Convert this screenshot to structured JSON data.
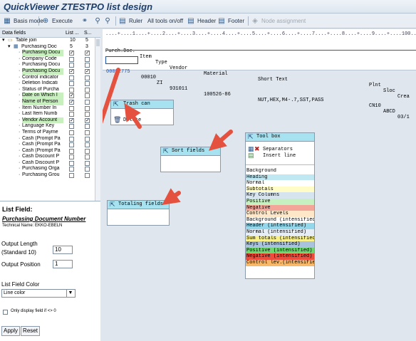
{
  "window": {
    "title": "QuickViewer ZTESTPO list design"
  },
  "toolbar": {
    "basis_mode": "Basis mode",
    "execute": "Execute",
    "ruler": "Ruler",
    "all_tools": "All tools on/off",
    "header": "Header",
    "footer": "Footer",
    "node_assignment": "Node assignment"
  },
  "tree": {
    "col_fields": "Data fields",
    "col_list": "List ...",
    "col_s": "S...",
    "rows": [
      {
        "label": "Table join",
        "list": "10",
        "s": "5"
      },
      {
        "label": "Purchasing Docu",
        "list": "5",
        "s": "3"
      },
      {
        "label": "Purchasing Docu"
      },
      {
        "label": "Company Code"
      },
      {
        "label": "Purchasing Docu"
      },
      {
        "label": "Purchasing Docu"
      },
      {
        "label": "Control indicator"
      },
      {
        "label": "Deletion Indicati"
      },
      {
        "label": "Status of Purcha"
      },
      {
        "label": "Date on Which I"
      },
      {
        "label": "Name of Person"
      },
      {
        "label": "Item Number In"
      },
      {
        "label": "Last Item Numb"
      },
      {
        "label": "Vendor Account"
      },
      {
        "label": "Language Key"
      },
      {
        "label": "Terms of Payme"
      },
      {
        "label": "Cash (Prompt Pa"
      },
      {
        "label": "Cash (Prompt Pa"
      },
      {
        "label": "Cash (Prompt Pa"
      },
      {
        "label": "Cash Discount P"
      },
      {
        "label": "Cash Discount P"
      },
      {
        "label": "Purchasing Orga"
      },
      {
        "label": "Purchasing Grou"
      }
    ]
  },
  "field_panel": {
    "heading": "List Field:",
    "field_name": "Purchasing Document Number",
    "technical_name": "Technical Name: EKKO-EBELN",
    "output_length_label_1": "Output Length",
    "output_length_label_2": "(Standard 10)",
    "output_length_value": "10",
    "output_position_label": "Output Position",
    "output_position_value": "1",
    "color_label": "List Field Color",
    "color_value": "Line color",
    "only_display_label": "Only display field if <> 0",
    "apply_button": "Apply",
    "reset_button": "Reset"
  },
  "report": {
    "ruler": "....+....1....+....2....+....3....+....4....+....5....+....6....+....7....+....8....+....9....+....100....+",
    "header_cols": {
      "po": "Purch.Doc.",
      "item": "Item",
      "type": "Type",
      "vendor": "Vendor",
      "material": "Material",
      "short_text": "Short Text",
      "plnt": "Plnt",
      "sloc": "Sloc",
      "cre": "Crea"
    },
    "row": {
      "po": "00092775",
      "item": "00010",
      "type": "ZI",
      "vendor": "931011",
      "material": "100526-86",
      "short_text": "NUT,HEX,M4-.7,SST,PASS",
      "plnt": "CN10",
      "sloc": "ABCD",
      "cre": "03/1"
    }
  },
  "trash": {
    "title": "Trash can",
    "delete": "Delete"
  },
  "sort": {
    "title": "Sort fields"
  },
  "totaling": {
    "title": "Totaling fields"
  },
  "toolbox": {
    "title": "Tool box",
    "separators": "Separators",
    "insert_line": "Insert line",
    "colors": [
      {
        "label": "Background",
        "bg": "#ffffff"
      },
      {
        "label": "Heading",
        "bg": "#bfe8f2"
      },
      {
        "label": "Normal",
        "bg": "#ffffff"
      },
      {
        "label": "Subtotals",
        "bg": "#fffcc8"
      },
      {
        "label": "Key Columns",
        "bg": "#d6e4f0"
      },
      {
        "label": "Positive",
        "bg": "#c7f0c0"
      },
      {
        "label": "Negative",
        "bg": "#f3a59a"
      },
      {
        "label": "Control Levels",
        "bg": "#fde7c8"
      },
      {
        "label": "Background (intensified)",
        "bg": "#ffffff"
      },
      {
        "label": "Header (intensified)",
        "bg": "#94d6ea"
      },
      {
        "label": "Normal (intensified)",
        "bg": "#e6edf4"
      },
      {
        "label": "Sum totals (intensified)",
        "bg": "#f8f08a"
      },
      {
        "label": "Keys (intensified)",
        "bg": "#a9c2dd"
      },
      {
        "label": "Positive (intensified)",
        "bg": "#6fd670"
      },
      {
        "label": "Negative (intensified)",
        "bg": "#ee4d3d"
      },
      {
        "label": "Control lev.(intensified)",
        "bg": "#f7b86a"
      }
    ]
  }
}
